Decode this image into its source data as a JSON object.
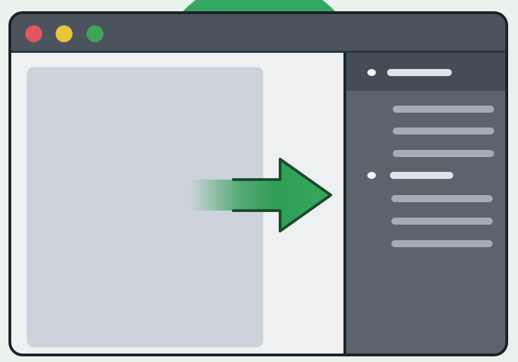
{
  "colors": {
    "background": "#e9f2ec",
    "accent_circle": "#34a860",
    "window_frame": "#1b2228",
    "titlebar": "#4b545c",
    "close_dot": "#e15560",
    "minimize_dot": "#e8c437",
    "maximize_dot": "#3fa35c",
    "document_area": "#eef0f2",
    "document_panel": "#ccd3da",
    "sidebar": "#5b646c",
    "sidebar_header": "#444d55",
    "arrow": "#2f9d55"
  },
  "window": {
    "controls": [
      {
        "name": "close",
        "color": "#e15560",
        "icon": "close-dot"
      },
      {
        "name": "minimize",
        "color": "#e8c437",
        "icon": "minimize-dot"
      },
      {
        "name": "maximize",
        "color": "#3fa35c",
        "icon": "maximize-dot"
      }
    ]
  },
  "arrow": {
    "icon": "arrow-right-icon",
    "direction": "right"
  },
  "sidebar": {
    "header_icon": "bullet-icon",
    "section_icon": "bullet-icon"
  }
}
